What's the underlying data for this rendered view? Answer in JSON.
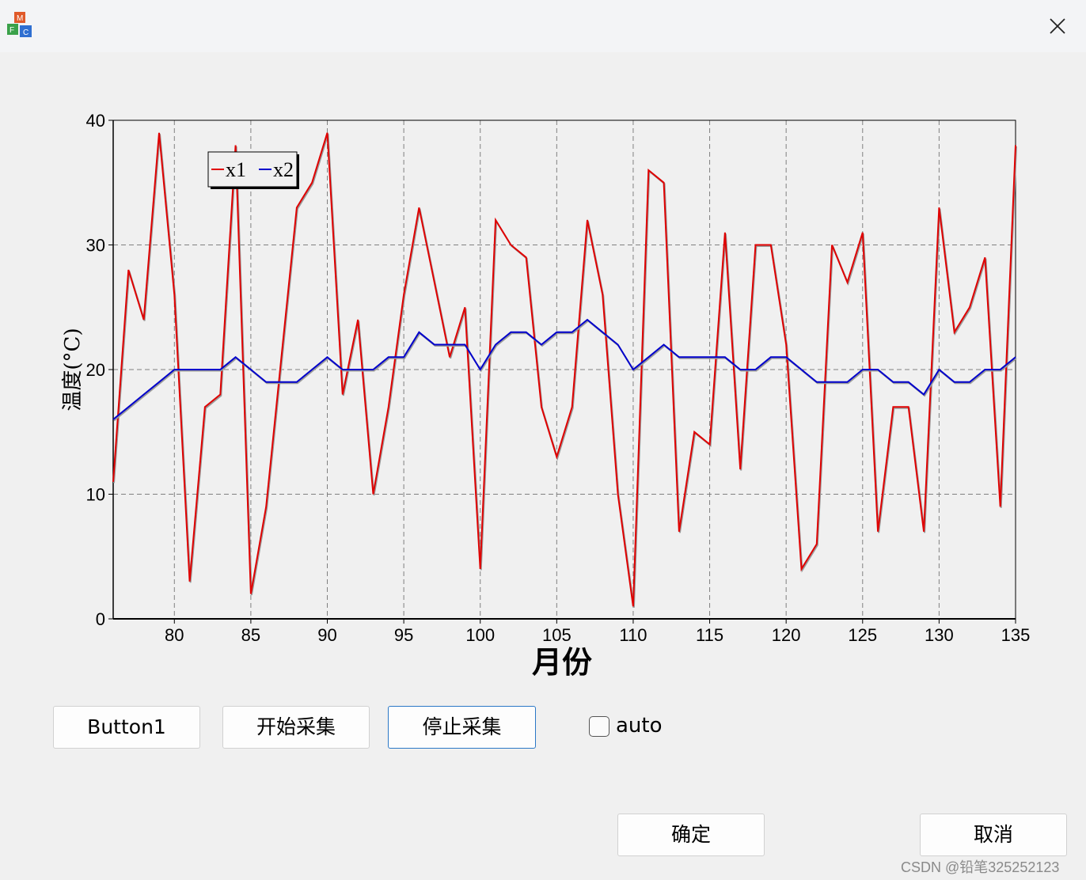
{
  "window": {
    "icon": "app-cube-icon",
    "close_icon": "close-icon"
  },
  "chart_data": {
    "type": "line",
    "xlabel": "月份",
    "ylabel": "温度(°C)",
    "xlim": [
      76,
      135
    ],
    "ylim": [
      0,
      40
    ],
    "x_ticks": [
      80,
      85,
      90,
      95,
      100,
      105,
      110,
      115,
      120,
      125,
      130,
      135
    ],
    "y_ticks": [
      0,
      10,
      20,
      30,
      40
    ],
    "grid": true,
    "legend_position": "top-left",
    "x": [
      76,
      77,
      78,
      79,
      80,
      81,
      82,
      83,
      84,
      85,
      86,
      87,
      88,
      89,
      90,
      91,
      92,
      93,
      94,
      95,
      96,
      97,
      98,
      99,
      100,
      101,
      102,
      103,
      104,
      105,
      106,
      107,
      108,
      109,
      110,
      111,
      112,
      113,
      114,
      115,
      116,
      117,
      118,
      119,
      120,
      121,
      122,
      123,
      124,
      125,
      126,
      127,
      128,
      129,
      130,
      131,
      132,
      133,
      134,
      135
    ],
    "series": [
      {
        "name": "x1",
        "color": "#e00000",
        "values": [
          11,
          28,
          24,
          39,
          26,
          3,
          17,
          18,
          38,
          2,
          9,
          21,
          33,
          35,
          39,
          18,
          24,
          10,
          17,
          26,
          33,
          27,
          21,
          25,
          4,
          32,
          30,
          29,
          17,
          13,
          17,
          32,
          26,
          10,
          1,
          36,
          35,
          7,
          15,
          14,
          31,
          12,
          30,
          30,
          22,
          4,
          6,
          30,
          27,
          31,
          7,
          17,
          17,
          7,
          33,
          23,
          25,
          29,
          9,
          38
        ]
      },
      {
        "name": "x2",
        "color": "#0000cc",
        "values": [
          16,
          17,
          18,
          19,
          20,
          20,
          20,
          20,
          21,
          20,
          19,
          19,
          19,
          20,
          21,
          20,
          20,
          20,
          21,
          21,
          23,
          22,
          22,
          22,
          20,
          22,
          23,
          23,
          22,
          23,
          23,
          24,
          23,
          22,
          20,
          21,
          22,
          21,
          21,
          21,
          21,
          20,
          20,
          21,
          21,
          20,
          19,
          19,
          19,
          20,
          20,
          19,
          19,
          18,
          20,
          19,
          19,
          20,
          20,
          21
        ]
      }
    ]
  },
  "buttons": {
    "button1": "Button1",
    "start": "开始采集",
    "stop": "停止采集",
    "ok": "确定",
    "cancel": "取消"
  },
  "auto_checkbox": {
    "label": "auto",
    "checked": false
  },
  "watermark": "CSDN @铅笔325252123"
}
